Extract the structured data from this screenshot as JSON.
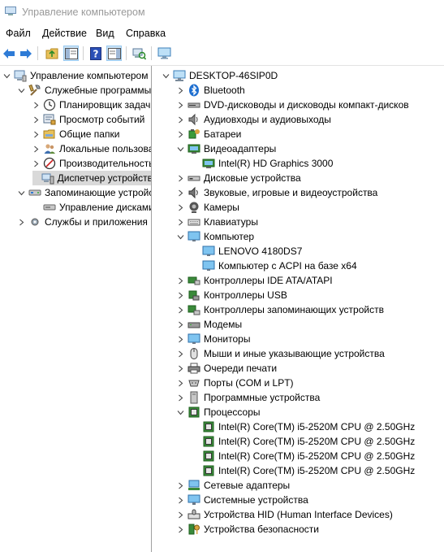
{
  "window": {
    "title": "Управление компьютером"
  },
  "menu": [
    "Файл",
    "Действие",
    "Вид",
    "Справка"
  ],
  "left_tree": [
    {
      "label": "Управление компьютером (л",
      "depth": 0,
      "expanded": true,
      "icon": "computer-management-icon"
    },
    {
      "label": "Служебные программы",
      "depth": 1,
      "expanded": true,
      "icon": "tools-icon"
    },
    {
      "label": "Планировщик задач",
      "depth": 2,
      "expanded": false,
      "icon": "clock-icon"
    },
    {
      "label": "Просмотр событий",
      "depth": 2,
      "expanded": false,
      "icon": "event-viewer-icon"
    },
    {
      "label": "Общие папки",
      "depth": 2,
      "expanded": false,
      "icon": "shared-folder-icon"
    },
    {
      "label": "Локальные пользовате",
      "depth": 2,
      "expanded": false,
      "icon": "users-icon"
    },
    {
      "label": "Производительность",
      "depth": 2,
      "expanded": false,
      "icon": "performance-icon"
    },
    {
      "label": "Диспетчер устройств",
      "depth": 2,
      "expanded": null,
      "icon": "device-manager-icon",
      "selected": true
    },
    {
      "label": "Запоминающие устройст",
      "depth": 1,
      "expanded": true,
      "icon": "storage-icon"
    },
    {
      "label": "Управление дисками",
      "depth": 2,
      "expanded": null,
      "icon": "disk-management-icon"
    },
    {
      "label": "Службы и приложения",
      "depth": 1,
      "expanded": false,
      "icon": "services-icon"
    }
  ],
  "device_tree": [
    {
      "label": "DESKTOP-46SIP0D",
      "depth": 0,
      "expanded": true,
      "icon": "computer-icon"
    },
    {
      "label": "Bluetooth",
      "depth": 1,
      "expanded": false,
      "icon": "bluetooth-icon"
    },
    {
      "label": "DVD-дисководы и дисководы компакт-дисков",
      "depth": 1,
      "expanded": false,
      "icon": "dvd-drive-icon"
    },
    {
      "label": "Аудиовходы и аудиовыходы",
      "depth": 1,
      "expanded": false,
      "icon": "audio-io-icon"
    },
    {
      "label": "Батареи",
      "depth": 1,
      "expanded": false,
      "icon": "battery-icon"
    },
    {
      "label": "Видеоадаптеры",
      "depth": 1,
      "expanded": true,
      "icon": "display-adapter-icon"
    },
    {
      "label": "Intel(R) HD Graphics 3000",
      "depth": 2,
      "expanded": null,
      "icon": "display-adapter-icon"
    },
    {
      "label": "Дисковые устройства",
      "depth": 1,
      "expanded": false,
      "icon": "disk-drive-icon"
    },
    {
      "label": "Звуковые, игровые и видеоустройства",
      "depth": 1,
      "expanded": false,
      "icon": "speaker-icon"
    },
    {
      "label": "Камеры",
      "depth": 1,
      "expanded": false,
      "icon": "camera-icon"
    },
    {
      "label": "Клавиатуры",
      "depth": 1,
      "expanded": false,
      "icon": "keyboard-icon"
    },
    {
      "label": "Компьютер",
      "depth": 1,
      "expanded": true,
      "icon": "monitor-icon"
    },
    {
      "label": "LENOVO 4180DS7",
      "depth": 2,
      "expanded": null,
      "icon": "monitor-icon"
    },
    {
      "label": "Компьютер с ACPI на базе x64",
      "depth": 2,
      "expanded": null,
      "icon": "monitor-icon"
    },
    {
      "label": "Контроллеры IDE ATA/ATAPI",
      "depth": 1,
      "expanded": false,
      "icon": "ide-controller-icon"
    },
    {
      "label": "Контроллеры USB",
      "depth": 1,
      "expanded": false,
      "icon": "usb-icon"
    },
    {
      "label": "Контроллеры запоминающих устройств",
      "depth": 1,
      "expanded": false,
      "icon": "storage-controller-icon"
    },
    {
      "label": "Модемы",
      "depth": 1,
      "expanded": false,
      "icon": "modem-icon"
    },
    {
      "label": "Мониторы",
      "depth": 1,
      "expanded": false,
      "icon": "monitor-icon"
    },
    {
      "label": "Мыши и иные указывающие устройства",
      "depth": 1,
      "expanded": false,
      "icon": "mouse-icon"
    },
    {
      "label": "Очереди печати",
      "depth": 1,
      "expanded": false,
      "icon": "printer-icon"
    },
    {
      "label": "Порты (COM и LPT)",
      "depth": 1,
      "expanded": false,
      "icon": "port-icon"
    },
    {
      "label": "Программные устройства",
      "depth": 1,
      "expanded": false,
      "icon": "software-device-icon"
    },
    {
      "label": "Процессоры",
      "depth": 1,
      "expanded": true,
      "icon": "processor-icon"
    },
    {
      "label": "Intel(R) Core(TM) i5-2520M CPU @ 2.50GHz",
      "depth": 2,
      "expanded": null,
      "icon": "processor-icon"
    },
    {
      "label": "Intel(R) Core(TM) i5-2520M CPU @ 2.50GHz",
      "depth": 2,
      "expanded": null,
      "icon": "processor-icon"
    },
    {
      "label": "Intel(R) Core(TM) i5-2520M CPU @ 2.50GHz",
      "depth": 2,
      "expanded": null,
      "icon": "processor-icon"
    },
    {
      "label": "Intel(R) Core(TM) i5-2520M CPU @ 2.50GHz",
      "depth": 2,
      "expanded": null,
      "icon": "processor-icon"
    },
    {
      "label": "Сетевые адаптеры",
      "depth": 1,
      "expanded": false,
      "icon": "network-adapter-icon"
    },
    {
      "label": "Системные устройства",
      "depth": 1,
      "expanded": false,
      "icon": "system-device-icon"
    },
    {
      "label": "Устройства HID (Human Interface Devices)",
      "depth": 1,
      "expanded": false,
      "icon": "hid-icon"
    },
    {
      "label": "Устройства безопасности",
      "depth": 1,
      "expanded": false,
      "icon": "security-device-icon"
    }
  ],
  "toolbar": [
    {
      "name": "back-button",
      "icon": "arrow-left-icon"
    },
    {
      "name": "forward-button",
      "icon": "arrow-right-icon"
    },
    {
      "name": "up-button",
      "icon": "folder-up-icon"
    },
    {
      "name": "show-hide-tree-button",
      "icon": "console-tree-icon"
    },
    {
      "name": "help-button",
      "icon": "help-icon"
    },
    {
      "name": "action-pane-button",
      "icon": "action-pane-icon"
    },
    {
      "name": "scan-hardware-button",
      "icon": "scan-hardware-icon"
    },
    {
      "name": "monitor-view-button",
      "icon": "monitor-view-icon"
    }
  ]
}
